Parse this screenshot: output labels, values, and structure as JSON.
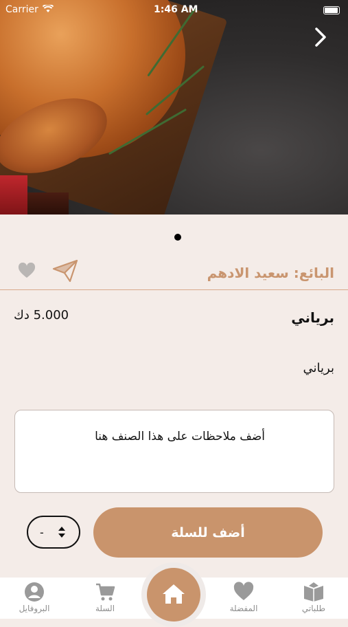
{
  "status_bar": {
    "carrier": "Carrier",
    "time": "1:46 AM"
  },
  "seller": {
    "label": "البائع: سعيد الادهم"
  },
  "product": {
    "name": "برياني",
    "price": "5.000 دك",
    "description": "برياني"
  },
  "notes": {
    "placeholder": "أضف ملاحظات على هذا الصنف هنا"
  },
  "quantity": {
    "value": "-"
  },
  "cart": {
    "add_label": "أضف للسلة"
  },
  "tabbar": {
    "items": [
      {
        "label": "البروفايل",
        "icon": "profile-icon"
      },
      {
        "label": "السلة",
        "icon": "cart-icon"
      },
      {
        "label": "",
        "icon": "home-icon"
      },
      {
        "label": "المفضلة",
        "icon": "heart-icon"
      },
      {
        "label": "طلباتي",
        "icon": "orders-icon"
      }
    ]
  },
  "colors": {
    "accent": "#c9946c",
    "seller_text": "#c9956f",
    "background": "#f4ece8"
  }
}
